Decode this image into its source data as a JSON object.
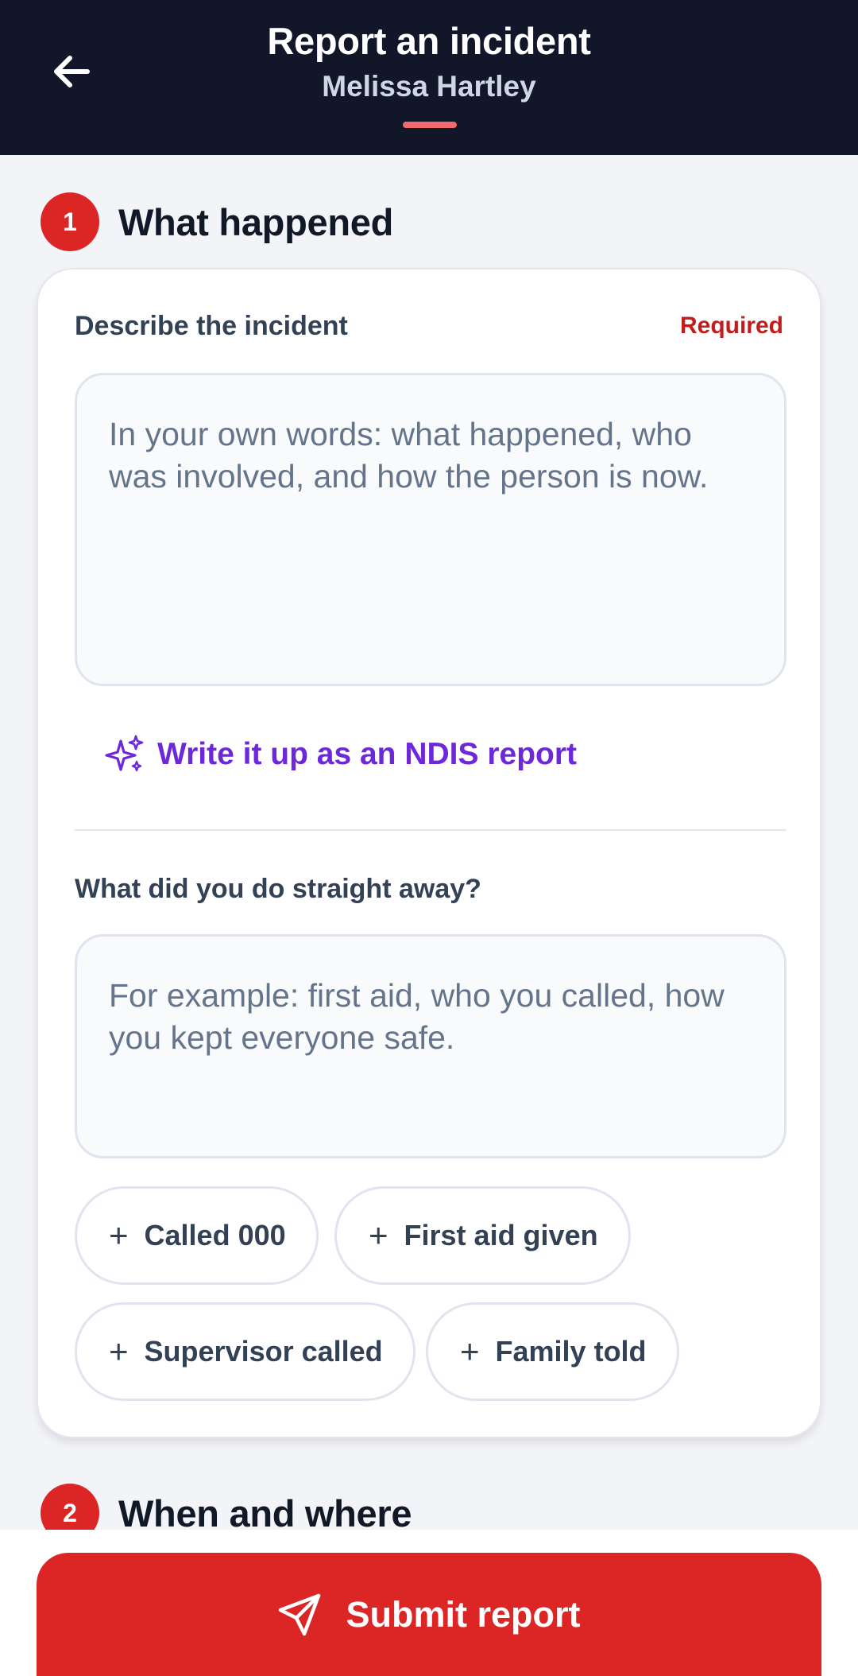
{
  "header": {
    "title": "Report an incident",
    "subtitle": "Melissa Hartley",
    "back_icon": "arrow-left-icon",
    "accent": "#f06b6b"
  },
  "sections": [
    {
      "number": "1",
      "title": "What happened"
    },
    {
      "number": "2",
      "title": "When and where"
    }
  ],
  "card": {
    "describe_label": "Describe the incident",
    "required_label": "Required",
    "describe_placeholder": "In your own words: what happened, who was involved, and how the person is now.",
    "describe_value": "",
    "ai_link_label": "Write it up as an NDIS report",
    "ai_icon": "sparkles-icon",
    "actions_label": "What did you do straight away?",
    "actions_placeholder": "For example: first aid, who you called, how you kept everyone safe.",
    "actions_value": "",
    "chips": [
      "Called 000",
      "First aid given",
      "Supervisor called",
      "Family told"
    ]
  },
  "submit": {
    "label": "Submit report",
    "icon": "send-icon",
    "color": "#dc2626"
  }
}
